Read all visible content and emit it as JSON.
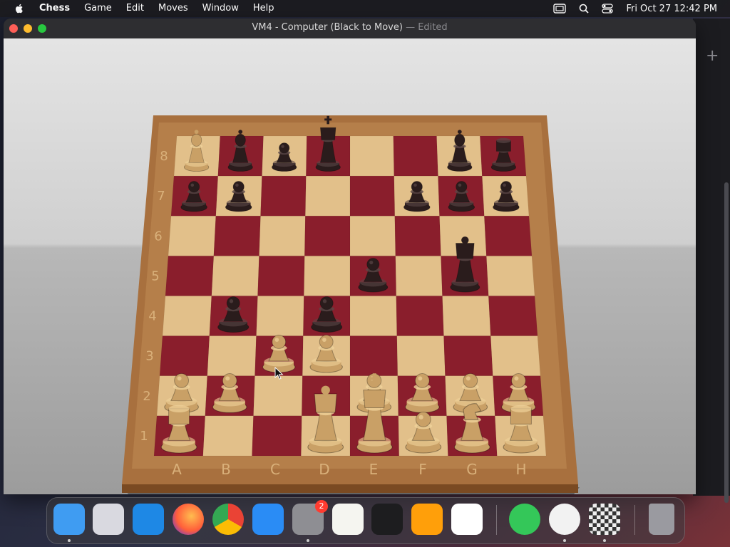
{
  "menubar": {
    "app": "Chess",
    "items": [
      "Game",
      "Edit",
      "Moves",
      "Window",
      "Help"
    ],
    "clock": "Fri Oct 27  12:42 PM"
  },
  "window": {
    "title": "VM4 - Computer   (Black to Move)",
    "edited": "— Edited"
  },
  "board": {
    "files": [
      "A",
      "B",
      "C",
      "D",
      "E",
      "F",
      "G",
      "H"
    ],
    "ranks": [
      "1",
      "2",
      "3",
      "4",
      "5",
      "6",
      "7",
      "8"
    ],
    "pieces": [
      {
        "sq": "a8",
        "color": "white",
        "type": "bishop"
      },
      {
        "sq": "b8",
        "color": "black",
        "type": "bishop"
      },
      {
        "sq": "c8",
        "color": "black",
        "type": "pawn"
      },
      {
        "sq": "d8",
        "color": "black",
        "type": "king"
      },
      {
        "sq": "g8",
        "color": "black",
        "type": "bishop"
      },
      {
        "sq": "h8",
        "color": "black",
        "type": "rook"
      },
      {
        "sq": "a7",
        "color": "black",
        "type": "pawn"
      },
      {
        "sq": "b7",
        "color": "black",
        "type": "pawn"
      },
      {
        "sq": "f7",
        "color": "black",
        "type": "pawn"
      },
      {
        "sq": "g7",
        "color": "black",
        "type": "pawn"
      },
      {
        "sq": "h7",
        "color": "black",
        "type": "pawn"
      },
      {
        "sq": "e5",
        "color": "black",
        "type": "pawn"
      },
      {
        "sq": "g5",
        "color": "black",
        "type": "queen"
      },
      {
        "sq": "b4",
        "color": "black",
        "type": "pawn"
      },
      {
        "sq": "d4",
        "color": "black",
        "type": "pawn"
      },
      {
        "sq": "c3",
        "color": "white",
        "type": "pawn"
      },
      {
        "sq": "d3",
        "color": "white",
        "type": "pawn"
      },
      {
        "sq": "a2",
        "color": "white",
        "type": "pawn"
      },
      {
        "sq": "b2",
        "color": "white",
        "type": "pawn"
      },
      {
        "sq": "e2",
        "color": "white",
        "type": "pawn"
      },
      {
        "sq": "f2",
        "color": "white",
        "type": "pawn"
      },
      {
        "sq": "g2",
        "color": "white",
        "type": "pawn"
      },
      {
        "sq": "h2",
        "color": "white",
        "type": "pawn"
      },
      {
        "sq": "a1",
        "color": "white",
        "type": "rook"
      },
      {
        "sq": "d1",
        "color": "white",
        "type": "queen"
      },
      {
        "sq": "e1",
        "color": "white",
        "type": "king"
      },
      {
        "sq": "f1",
        "color": "white",
        "type": "pawn"
      },
      {
        "sq": "g1",
        "color": "white",
        "type": "knight"
      },
      {
        "sq": "h1",
        "color": "white",
        "type": "rook"
      }
    ],
    "colors": {
      "light": "#e2c08a",
      "dark": "#8a1e2c",
      "frame": "#a8703e",
      "white_piece": "#c9a066",
      "black_piece": "#2a1c1c"
    }
  },
  "dock": {
    "apps": [
      {
        "name": "finder",
        "color": "#3f9cf2"
      },
      {
        "name": "launchpad",
        "color": "#d9d9e0"
      },
      {
        "name": "safari",
        "color": "#1e88e5"
      },
      {
        "name": "firefox",
        "color": "#ff7a1a"
      },
      {
        "name": "chrome",
        "color": "#e8e8e8"
      },
      {
        "name": "app-store",
        "color": "#2a8cf5"
      },
      {
        "name": "system-settings",
        "color": "#8e8e93",
        "badge": "2"
      },
      {
        "name": "textedit",
        "color": "#f5f5f0"
      },
      {
        "name": "terminal",
        "color": "#1d1d1f"
      },
      {
        "name": "garageband",
        "color": "#ff9f0a"
      },
      {
        "name": "vscode",
        "color": "#ffffff"
      },
      {
        "name": "find-my",
        "color": "#34c759"
      },
      {
        "name": "clock",
        "color": "#f2f2f2"
      },
      {
        "name": "chess",
        "color": "#5a5a5a"
      },
      {
        "name": "trash",
        "color": "#9a9aa0"
      }
    ]
  }
}
